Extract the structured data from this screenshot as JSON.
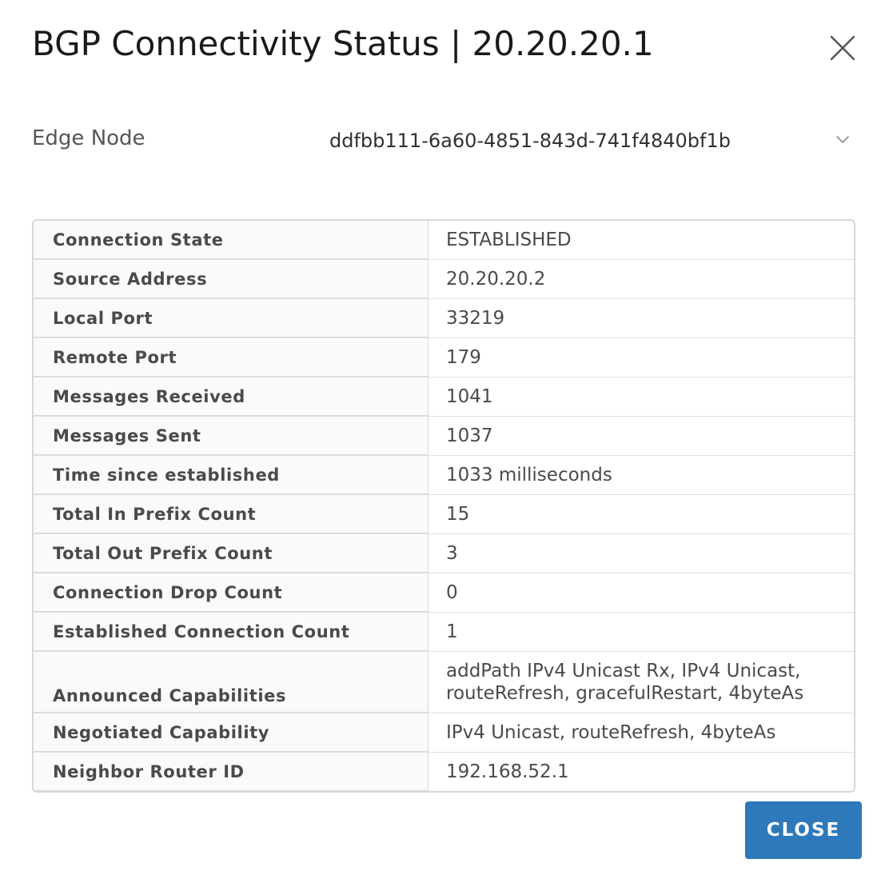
{
  "dialog": {
    "title": "BGP Connectivity Status | 20.20.20.1",
    "close_icon": "close-icon"
  },
  "edge_node": {
    "label": "Edge Node",
    "selected_value": "ddfbb111-6a60-4851-843d-741f4840bf1b",
    "dropdown_icon": "chevron-down-icon"
  },
  "status_table": {
    "rows": [
      {
        "label": "Connection State",
        "value": "ESTABLISHED"
      },
      {
        "label": "Source Address",
        "value": "20.20.20.2"
      },
      {
        "label": "Local Port",
        "value": "33219"
      },
      {
        "label": "Remote Port",
        "value": "179"
      },
      {
        "label": "Messages Received",
        "value": "1041"
      },
      {
        "label": "Messages Sent",
        "value": "1037"
      },
      {
        "label": "Time since established",
        "value": "1033 milliseconds"
      },
      {
        "label": "Total In Prefix Count",
        "value": "15"
      },
      {
        "label": "Total Out Prefix Count",
        "value": "3"
      },
      {
        "label": "Connection Drop Count",
        "value": "0"
      },
      {
        "label": "Established Connection Count",
        "value": "1"
      },
      {
        "label": "Announced Capabilities",
        "value": "addPath IPv4 Unicast Rx, IPv4 Unicast, routeRefresh, gracefulRestart, 4byteAs"
      },
      {
        "label": "Negotiated Capability",
        "value": "IPv4 Unicast, routeRefresh, 4byteAs"
      },
      {
        "label": "Neighbor Router ID",
        "value": "192.168.52.1"
      }
    ]
  },
  "footer": {
    "close_label": "CLOSE"
  },
  "colors": {
    "primary_button": "#2e79b9",
    "label_background": "#fafafa",
    "border": "#d7d7d7"
  }
}
